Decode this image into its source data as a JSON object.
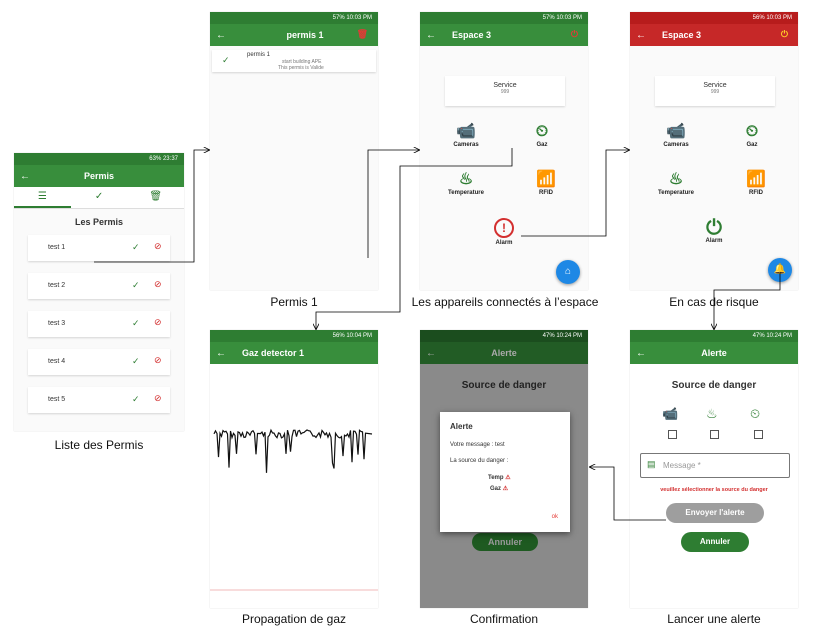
{
  "colors": {
    "green": "#388e3c",
    "dark_green": "#2e7d32",
    "red_bar": "#c62828",
    "fab_blue": "#1e88e5",
    "alarm_red": "#d32f2f"
  },
  "status": {
    "phone1": "63% 23:37",
    "phone2": "57% 10:03 PM",
    "phone3": "57% 10:03 PM",
    "phone4": "56% 10:03 PM",
    "phone5": "56% 10:04 PM",
    "phone6": "47% 10:24 PM",
    "phone7": "47% 10:24 PM"
  },
  "permis_list": {
    "title": "Permis",
    "header": "Les Permis",
    "items": [
      "test 1",
      "test 2",
      "test 3",
      "test 4",
      "test 5"
    ],
    "caption": "Liste des Permis"
  },
  "permis1": {
    "title": "permis 1",
    "item_title": "permis 1",
    "item_line1": "start building APE",
    "item_line2": "This permis is Valide",
    "caption": "Permis 1"
  },
  "espace": {
    "title": "Espace 3",
    "service_label": "Service",
    "service_value": "999",
    "devices": {
      "cameras": "Cameras",
      "gaz": "Gaz",
      "temperature": "Temperature",
      "rfid": "RFID",
      "alarm": "Alarm"
    },
    "caption": "Les appareils connectés  à l’espace"
  },
  "espace_risk": {
    "caption": "En cas de risque"
  },
  "gaz": {
    "title": "Gaz detector 1",
    "caption": "Propagation de gaz"
  },
  "confirm": {
    "title": "Alerte",
    "bg_header": "Source de danger",
    "dialog_title": "Alerte",
    "message_line": "Votre message : test",
    "source_line": "La source du danger :",
    "source1": "Temp",
    "source2": "Gaz",
    "ok": "ok",
    "annuler": "Annuler",
    "caption": "Confirmation"
  },
  "alert": {
    "title": "Alerte",
    "header": "Source de danger",
    "message_placeholder": "Message *",
    "error": "veuillez sélectionner la source du danger",
    "send": "Envoyer l'alerte",
    "cancel": "Annuler",
    "caption": "Lancer une alerte"
  }
}
